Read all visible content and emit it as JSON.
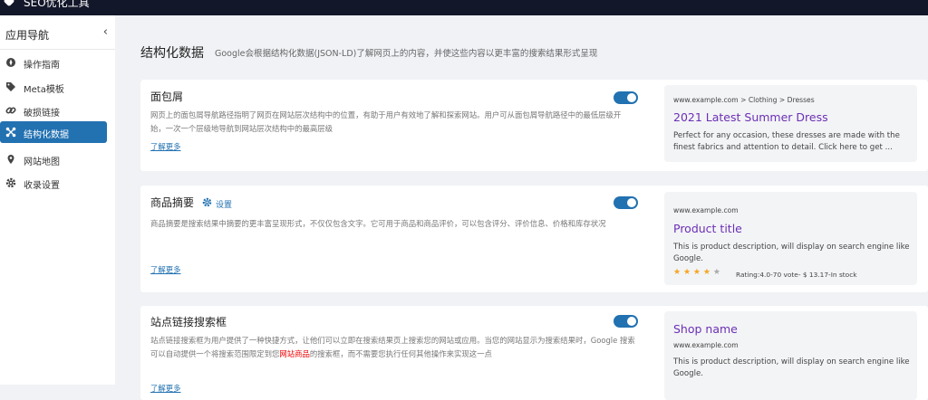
{
  "topbar": {
    "title": "SEO优化工具"
  },
  "sidebar": {
    "header": "应用导航",
    "items": [
      {
        "label": "操作指南",
        "icon": "compass-icon"
      },
      {
        "label": "Meta模板",
        "icon": "tag-icon"
      },
      {
        "label": "破损链接",
        "icon": "link-icon"
      },
      {
        "label": "结构化数据",
        "icon": "structure-icon",
        "active": true
      },
      {
        "label": "网站地图",
        "icon": "map-icon"
      },
      {
        "label": "收录设置",
        "icon": "gear-icon"
      }
    ]
  },
  "main": {
    "title": "结构化数据",
    "description": "Google会根据结构化数据(JSON-LD)了解网页上的内容，并使这些内容以更丰富的搜索结果形式呈现"
  },
  "cards": [
    {
      "title": "面包屑",
      "enabled": true,
      "description": "网页上的面包屑导航路径指明了网页在网站层次结构中的位置，有助于用户有效地了解和探索网站。用户可从面包屑导航路径中的最低层级开始，一次一个层级地导航到网站层次结构中的最高层级",
      "more": "了解更多",
      "preview": {
        "url": "www.example.com >  Clothing  >  Dresses",
        "title": "2021 Latest Summer Dress",
        "desc": "Perfect for any occasion, these dresses are made with the finest fabrics and attention to detail. Click here to get ..."
      }
    },
    {
      "title": "商品摘要",
      "enabled": true,
      "settings": "设置",
      "description": "商品摘要是搜索结果中摘要的更丰富呈现形式，不仅仅包含文字。它可用于商品和商品评价，可以包含评分、评价信息、价格和库存状况",
      "more": "了解更多",
      "preview": {
        "url": "www.example.com",
        "title": "Product title",
        "desc": "This is product description, will display on search engine like Google.",
        "rating_value": 4,
        "rating_max": 5,
        "rating_text": "Rating:4.0-70 vote- $ 13.17-In stock"
      }
    },
    {
      "title": "站点链接搜索框",
      "enabled": true,
      "description_pre": "站点链接搜索框为用户提供了一种快捷方式，让他们可以立即在搜索结果页上搜索您的网站或应用。当您的网站显示为搜索结果时，Google 搜索可以自动提供一个将搜索范围限定到您",
      "description_highlight": "网站商品",
      "description_post": "的搜索框，而不需要您执行任何其他操作来实现这一点",
      "more": "了解更多",
      "preview": {
        "title": "Shop name",
        "url": "www.example.com",
        "desc": "This is product description, will display on search engine like Google."
      }
    }
  ]
}
